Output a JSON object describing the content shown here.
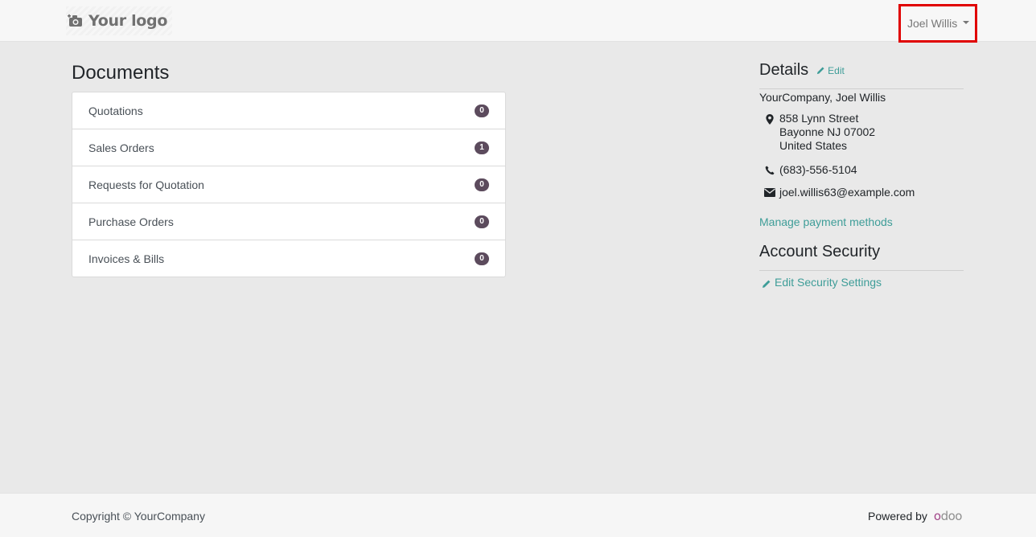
{
  "header": {
    "logo_text": "Your logo",
    "logo_icon": "camera-icon",
    "user_name": "Joel Willis"
  },
  "documents": {
    "title": "Documents",
    "items": [
      {
        "label": "Quotations",
        "count": "0"
      },
      {
        "label": "Sales Orders",
        "count": "1"
      },
      {
        "label": "Requests for Quotation",
        "count": "0"
      },
      {
        "label": "Purchase Orders",
        "count": "0"
      },
      {
        "label": "Invoices & Bills",
        "count": "0"
      }
    ]
  },
  "details": {
    "title": "Details",
    "edit_label": "Edit",
    "company": "YourCompany, Joel Willis",
    "address_lines": [
      "858 Lynn Street",
      "Bayonne NJ 07002",
      "United States"
    ],
    "phone": "(683)-556-5104",
    "email": "joel.willis63@example.com",
    "manage_payment_label": "Manage payment methods"
  },
  "security": {
    "title": "Account Security",
    "edit_label": "Edit Security Settings"
  },
  "footer": {
    "copyright": "Copyright © YourCompany",
    "powered_by": "Powered by",
    "brand": "odoo"
  },
  "colors": {
    "accent": "#3e9d98",
    "badge": "#5c4b5d",
    "highlight_border": "#e00000"
  }
}
